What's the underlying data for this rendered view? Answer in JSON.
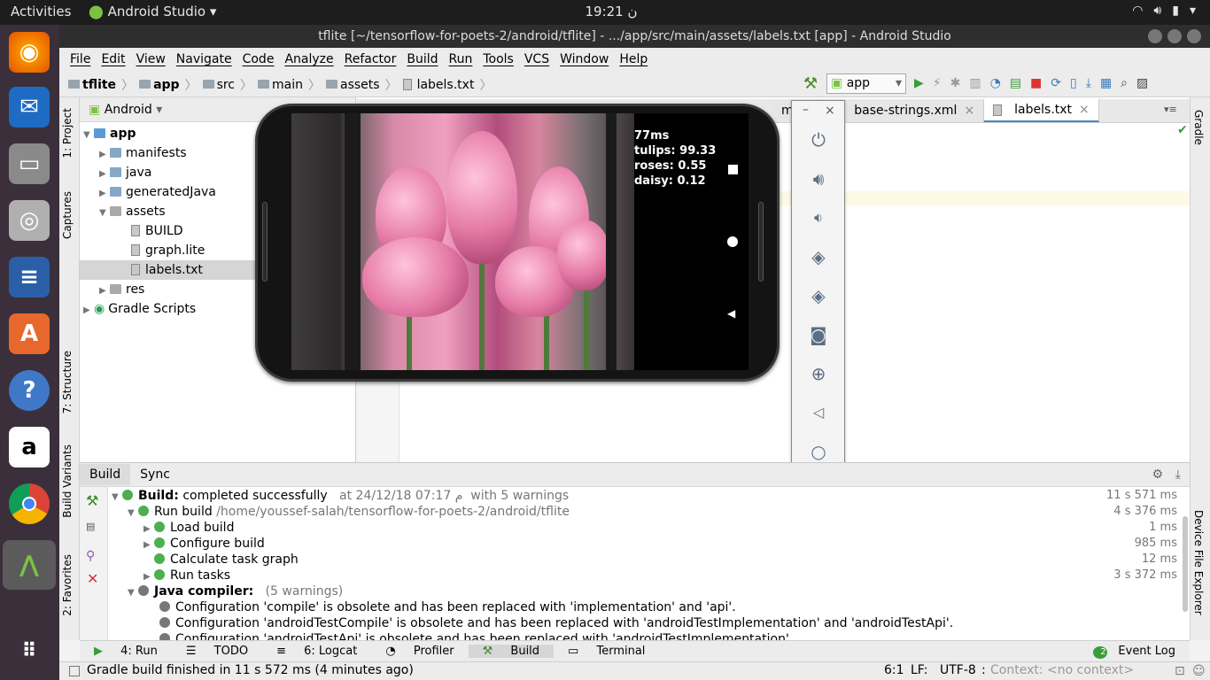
{
  "topbar": {
    "activities": "Activities",
    "app": "Android Studio ▾",
    "clock": "19:21 ن"
  },
  "window": {
    "title": "tflite [~/tensorflow-for-poets-2/android/tflite] - .../app/src/main/assets/labels.txt [app] - Android Studio"
  },
  "menu": [
    "File",
    "Edit",
    "View",
    "Navigate",
    "Code",
    "Analyze",
    "Refactor",
    "Build",
    "Run",
    "Tools",
    "VCS",
    "Window",
    "Help"
  ],
  "breadcrumbs": [
    "tflite",
    "app",
    "src",
    "main",
    "assets",
    "labels.txt"
  ],
  "run_config": "app",
  "left_tabs": {
    "project": "1: Project",
    "captures": "Captures",
    "structure": "7: Structure",
    "build_variants": "Build Variants",
    "favorites": "2: Favorites"
  },
  "right_tabs": {
    "gradle": "Gradle",
    "device_file_explorer": "Device File Explorer"
  },
  "project": {
    "view": "Android",
    "tree": {
      "app": "app",
      "manifests": "manifests",
      "java": "java",
      "generatedJava": "generatedJava",
      "assets": "assets",
      "build": "BUILD",
      "graph": "graph.lite",
      "labels": "labels.txt",
      "res": "res",
      "gradle": "Gradle Scripts"
    }
  },
  "editor_tabs": [
    "ml",
    "base-strings.xml",
    "labels.txt"
  ],
  "emulator": {
    "latency": "77ms",
    "results": [
      "tulips: 99.33",
      "roses: 0.55",
      "daisy: 0.12"
    ]
  },
  "build": {
    "tabs": [
      "Build",
      "Sync"
    ],
    "rows": {
      "r1_label": "Build:",
      "r1_text": "completed successfully",
      "r1_time": "at 24/12/18 07:17 م",
      "r1_warn": "with 5 warnings",
      "r1_dur": "11 s 571 ms",
      "r2_text": "Run build",
      "r2_path": "/home/youssef-salah/tensorflow-for-poets-2/android/tflite",
      "r2_dur": "4 s 376 ms",
      "r3_text": "Load build",
      "r3_dur": "1 ms",
      "r4_text": "Configure build",
      "r4_dur": "985 ms",
      "r5_text": "Calculate task graph",
      "r5_dur": "12 ms",
      "r6_text": "Run tasks",
      "r6_dur": "3 s 372 ms",
      "r7_label": "Java compiler:",
      "r7_count": "(5 warnings)",
      "w1": "Configuration 'compile' is obsolete and has been replaced with 'implementation' and 'api'.",
      "w2": "Configuration 'androidTestCompile' is obsolete and has been replaced with 'androidTestImplementation' and 'androidTestApi'.",
      "w3": "Configuration 'androidTestApi' is obsolete and has been replaced with 'androidTestImplementation'."
    }
  },
  "bottom_tools": {
    "run": "4: Run",
    "todo": "TODO",
    "logcat": "6: Logcat",
    "profiler": "Profiler",
    "build": "Build",
    "terminal": "Terminal",
    "eventlog": "Event Log",
    "eventcount": "2"
  },
  "status": {
    "message": "Gradle build finished in 11 s 572 ms (4 minutes ago)",
    "position": "6:1",
    "lf": "LF:",
    "encoding": "UTF-8",
    "context": "Context: <no context>"
  }
}
